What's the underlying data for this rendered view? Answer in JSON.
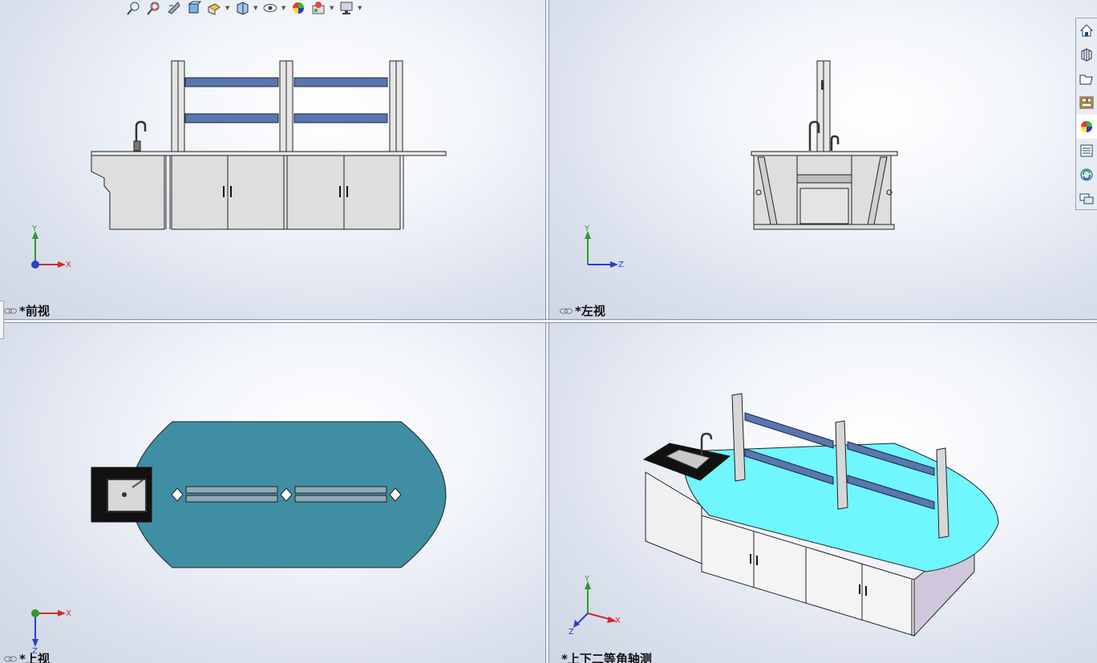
{
  "views": {
    "front": {
      "label": "*前视",
      "axis_a": "Y",
      "axis_b": "X"
    },
    "left": {
      "label": "*左视",
      "axis_a": "Y",
      "axis_b": "Z"
    },
    "top": {
      "label": "*上视",
      "axis_a": "X",
      "axis_b": "Z"
    },
    "iso": {
      "label": "*上下二等角轴测",
      "axis_a": "Y",
      "axis_b": "X",
      "axis_c": "Z"
    }
  },
  "hud_toolbar": {
    "icons": [
      "zoom-to-fit-icon",
      "zoom-to-area-icon",
      "previous-view-icon",
      "section-view-icon",
      "view-orientation-icon",
      "display-style-icon",
      "hide-show-items-icon",
      "edit-appearance-icon",
      "apply-scene-icon",
      "view-settings-icon"
    ]
  },
  "task_pane": {
    "icons": [
      "solidworks-resources-icon",
      "design-library-icon",
      "file-explorer-icon",
      "view-palette-icon",
      "appearances-scenes-icon",
      "custom-properties-icon",
      "solidworks-forum-icon",
      "feedback-icon"
    ],
    "active_index": 4
  },
  "colors": {
    "shelf_blue": "#5a76b0",
    "top_teal": "#3f8ea3",
    "iso_cyan": "#6ff6ff",
    "axis_y": "#2d9a2d",
    "axis_x": "#d12a2a",
    "axis_z": "#2a3fd1"
  }
}
